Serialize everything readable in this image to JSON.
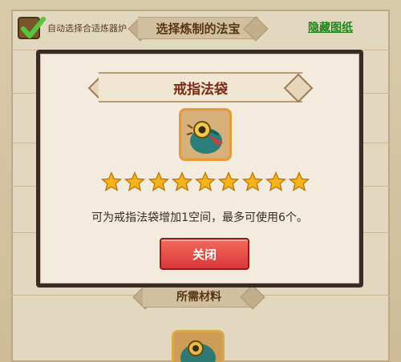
{
  "header": {
    "auto_select_label": "自动选择合适炼器炉",
    "auto_select_checked": true,
    "title": "选择炼制的法宝",
    "hide_link": "隐藏图纸"
  },
  "materials": {
    "title": "所需材料"
  },
  "modal": {
    "title": "戒指法袋",
    "item_icon": "cloth-bag-icon",
    "stars": 9,
    "description": "可为戒指法袋增加1空间，最多可使用6个。",
    "close_label": "关闭"
  },
  "colors": {
    "close_button": "#e5484a",
    "star": "#f5b21b",
    "link": "#1f8a1c"
  }
}
